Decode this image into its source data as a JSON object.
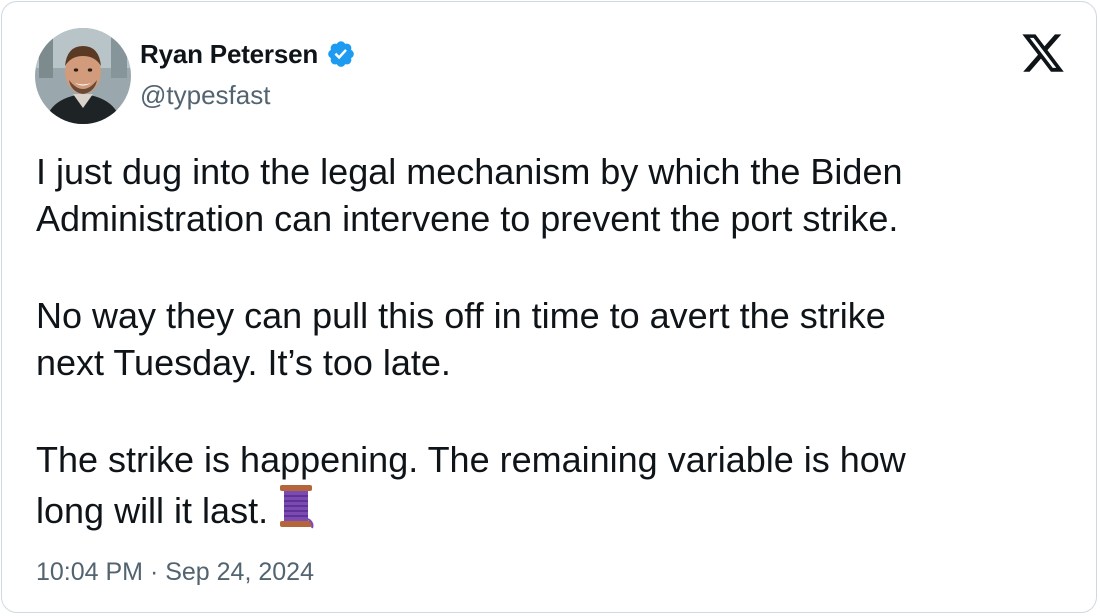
{
  "author": {
    "name": "Ryan Petersen",
    "handle": "@typesfast",
    "verified_icon": "verified-badge-icon",
    "verified_color": "#1d9bf0"
  },
  "platform_icon": "x-logo-icon",
  "tweet": {
    "paragraphs": [
      {
        "lines": [
          "I just dug into the legal mechanism by which the Biden",
          "Administration can intervene to prevent the port strike."
        ]
      },
      {
        "lines": [
          "No way they can pull this off in time to avert the strike",
          "next Tuesday. It’s too late."
        ]
      },
      {
        "lines": [
          "The strike is happening. The remaining variable is how",
          "long will it last."
        ],
        "trailing_emoji": "thread-spool-icon"
      }
    ]
  },
  "timestamp": "10:04 PM · Sep 24, 2024",
  "colors": {
    "text_primary": "#0f1419",
    "text_secondary": "#536471",
    "border": "#cfd9de",
    "verified": "#1d9bf0",
    "spool_thread": "#7b4bb3"
  }
}
